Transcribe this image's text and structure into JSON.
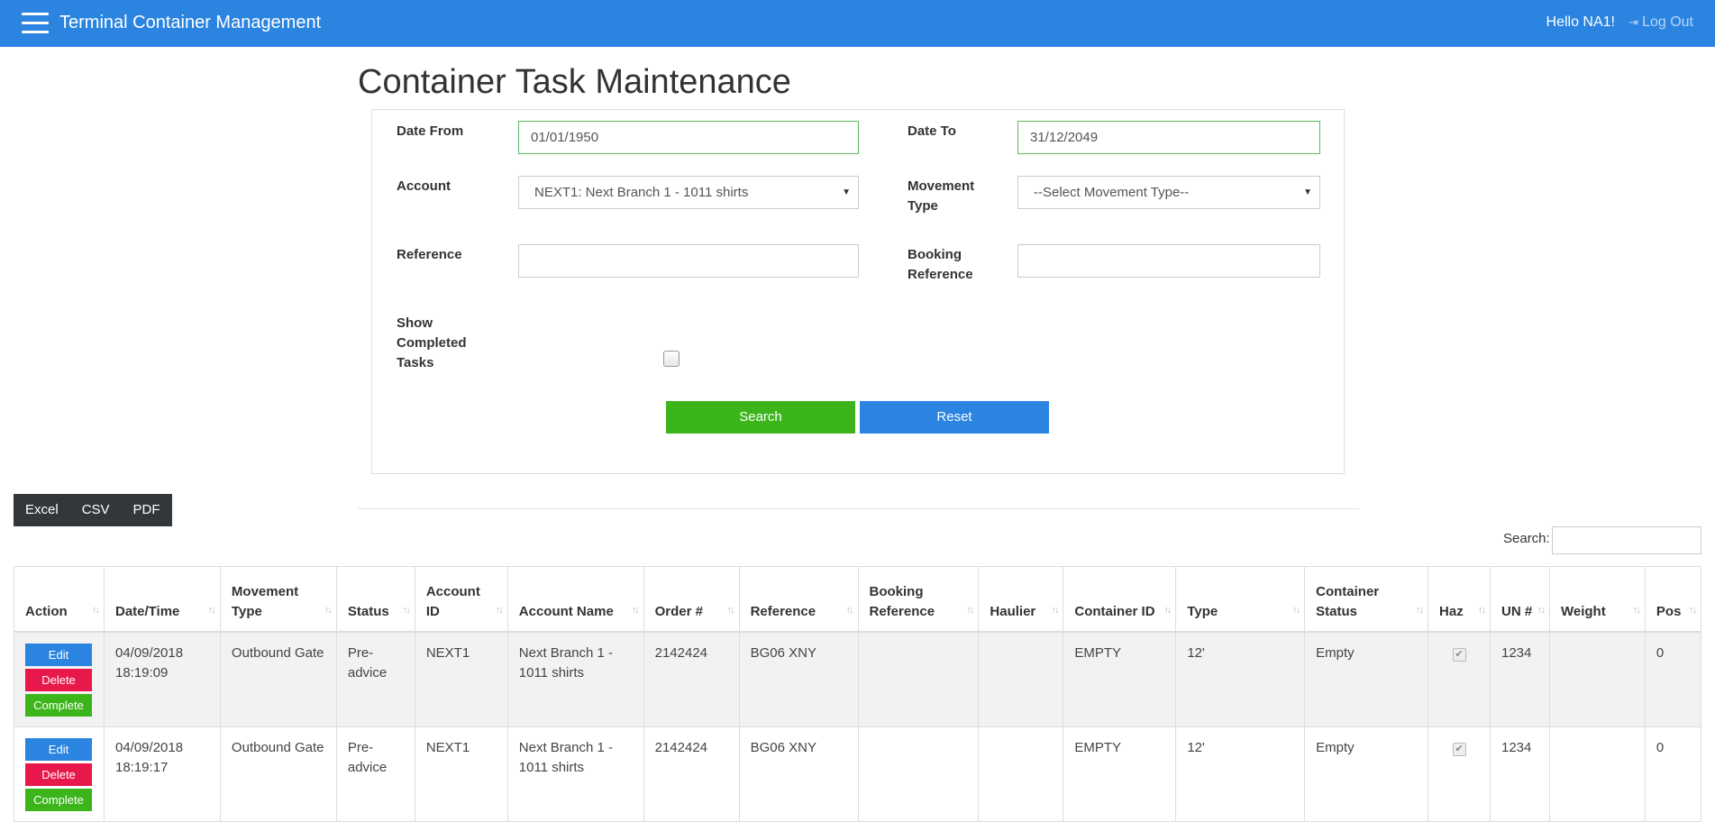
{
  "header": {
    "title": "Terminal Container Management",
    "greeting": "Hello NA1!",
    "logout": "Log Out"
  },
  "page": {
    "title": "Container Task Maintenance"
  },
  "filters": {
    "date_from_label": "Date From",
    "date_from_value": "01/01/1950",
    "date_to_label": "Date To",
    "date_to_value": "31/12/2049",
    "account_label": "Account",
    "account_value": "NEXT1: Next Branch 1 - 1011 shirts",
    "movement_type_label": "Movement Type",
    "movement_type_value": "--Select Movement Type--",
    "reference_label": "Reference",
    "reference_value": "",
    "booking_reference_label": "Booking Reference",
    "booking_reference_value": "",
    "show_completed_label": "Show Completed Tasks",
    "show_completed_checked": false,
    "search_button": "Search",
    "reset_button": "Reset"
  },
  "export": {
    "excel": "Excel",
    "csv": "CSV",
    "pdf": "PDF"
  },
  "table_search_label": "Search:",
  "table": {
    "columns": [
      "Action",
      "Date/Time",
      "Movement Type",
      "Status",
      "Account ID",
      "Account Name",
      "Order #",
      "Reference",
      "Booking Reference",
      "Haulier",
      "Container ID",
      "Type",
      "Container Status",
      "Haz",
      "UN #",
      "Weight",
      "Pos"
    ],
    "action_labels": {
      "edit": "Edit",
      "delete": "Delete",
      "complete": "Complete"
    },
    "rows": [
      {
        "datetime": "04/09/2018 18:19:09",
        "movement_type": "Outbound Gate",
        "status": "Pre-advice",
        "account_id": "NEXT1",
        "account_name": "Next Branch 1 - 1011 shirts",
        "order": "2142424",
        "reference": "BG06 XNY",
        "booking_reference": "",
        "haulier": "",
        "container_id": "EMPTY",
        "type": "12'",
        "container_status": "Empty",
        "haz": true,
        "un": "1234",
        "weight": "",
        "pos": "0"
      },
      {
        "datetime": "04/09/2018 18:19:17",
        "movement_type": "Outbound Gate",
        "status": "Pre-advice",
        "account_id": "NEXT1",
        "account_name": "Next Branch 1 - 1011 shirts",
        "order": "2142424",
        "reference": "BG06 XNY",
        "booking_reference": "",
        "haulier": "",
        "container_id": "EMPTY",
        "type": "12'",
        "container_status": "Empty",
        "haz": true,
        "un": "1234",
        "weight": "",
        "pos": "0"
      }
    ]
  },
  "colors": {
    "primary": "#2a84e0",
    "success": "#3cb51b",
    "danger": "#e8184a",
    "dark": "#33373b"
  }
}
